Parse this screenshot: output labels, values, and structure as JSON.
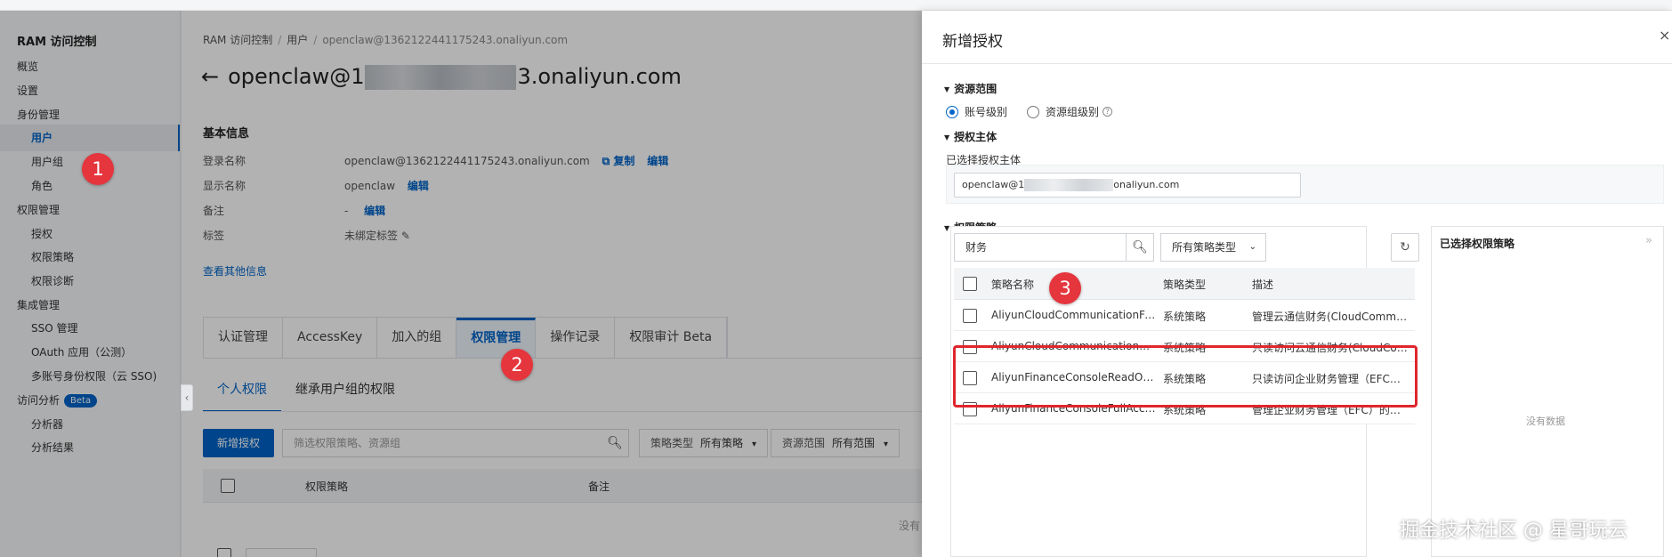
{
  "sidebar": {
    "brand": "RAM 访问控制",
    "items": [
      {
        "label": "概览"
      },
      {
        "label": "设置"
      },
      {
        "label": "身份管理"
      },
      {
        "label": "用户"
      },
      {
        "label": "用户组"
      },
      {
        "label": "角色"
      },
      {
        "label": "权限管理"
      },
      {
        "label": "授权"
      },
      {
        "label": "权限策略"
      },
      {
        "label": "权限诊断"
      },
      {
        "label": "集成管理"
      },
      {
        "label": "SSO 管理"
      },
      {
        "label": "OAuth 应用（公测）"
      },
      {
        "label": "多账号身份权限（云 SSO)"
      },
      {
        "label": "访问分析"
      },
      {
        "label": "分析器"
      },
      {
        "label": "分析结果"
      }
    ],
    "beta_badge": "Beta",
    "collapse_glyph": "‹"
  },
  "main": {
    "breadcrumb": [
      "RAM 访问控制",
      "用户",
      "openclaw@1362122441175243.onaliyun.com"
    ],
    "title_prefix": "openclaw@1",
    "title_suffix": "3.onaliyun.com",
    "basic_info_heading": "基本信息",
    "fields": [
      {
        "label": "登录名称",
        "value": "openclaw@1362122441175243.onaliyun.com"
      },
      {
        "label": "显示名称",
        "value": "openclaw"
      },
      {
        "label": "备注",
        "value": "-"
      },
      {
        "label": "标签",
        "value": "未绑定标签"
      }
    ],
    "copy_link": "复制",
    "edit_link": "编辑",
    "copy_icon": "⧉",
    "pencil_icon": "✎",
    "more_info_link": "查看其他信息",
    "tabs": [
      "认证管理",
      "AccessKey",
      "加入的组",
      "权限管理",
      "操作记录",
      "权限审计 Beta"
    ],
    "subtabs": [
      "个人权限",
      "继承用户组的权限"
    ],
    "add_button": "新增授权",
    "filter_placeholder": "筛选权限策略、资源组",
    "policy_type_label": "策略类型",
    "policy_type_value": "所有策略",
    "scope_label": "资源范围",
    "scope_value": "所有范围",
    "table_headers": [
      "权限策略",
      "备注"
    ],
    "no_data": "没有"
  },
  "drawer": {
    "title": "新增授权",
    "close_glyph": "×",
    "section_scope": "资源范围",
    "radio_account": "账号级别",
    "radio_resource_group": "资源组级别",
    "section_principal": "授权主体",
    "selected_principal_label": "已选择授权主体",
    "principal_prefix": "openclaw@1",
    "principal_suffix": "onaliyun.com",
    "section_policy": "权限策略",
    "search_value": "财务",
    "type_select": "所有策略类型",
    "table_headers": [
      "策略名称",
      "策略类型",
      "描述"
    ],
    "rows": [
      {
        "name": "AliyunCloudCommunicationFullAccess",
        "type": "系统策略",
        "desc": "管理云通信财务(CloudCommunication)的权限"
      },
      {
        "name": "AliyunCloudCommunicationReadOnlyAccess",
        "type": "系统策略",
        "desc": "只读访问云通信财务(CloudCommunication)的权限"
      },
      {
        "name": "AliyunFinanceConsoleReadOnlyAccess",
        "type": "系统策略",
        "desc": "只读访问企业财务管理（EFC）的权限"
      },
      {
        "name": "AliyunFinanceConsoleFullAccess",
        "type": "系统策略",
        "desc": "管理企业财务管理（EFC）的权限"
      }
    ],
    "selected_panel_title": "已选择权限策略",
    "selected_empty": "没有数据",
    "panel_chevron": "»",
    "refresh_glyph": "↻"
  },
  "annotations": [
    "1",
    "2",
    "3"
  ],
  "watermark": "掘金技术社区 @ 星哥玩云",
  "colors": {
    "accent": "#0064c8",
    "annotation": "#e5353d",
    "highlight_box": "#e0262d"
  }
}
